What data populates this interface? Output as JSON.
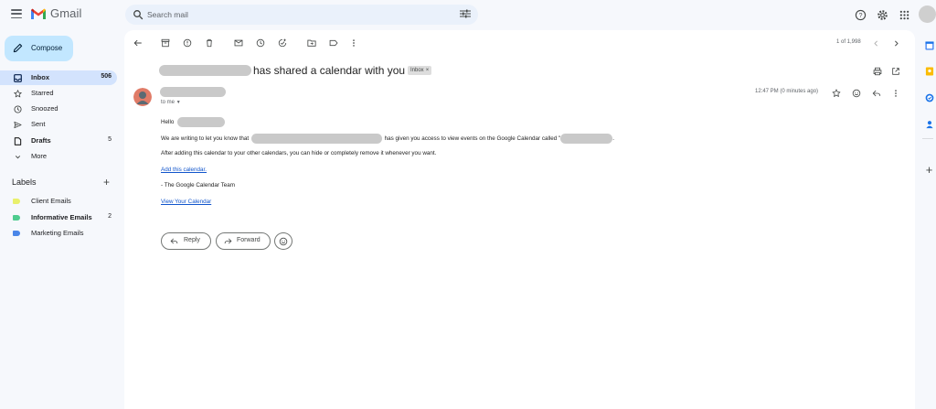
{
  "header": {
    "app_name": "Gmail",
    "search_placeholder": "Search mail"
  },
  "sidebar": {
    "compose_label": "Compose",
    "items": [
      {
        "label": "Inbox",
        "count": "506",
        "icon": "inbox-icon"
      },
      {
        "label": "Starred",
        "count": "",
        "icon": "star-icon"
      },
      {
        "label": "Snoozed",
        "count": "",
        "icon": "clock-icon"
      },
      {
        "label": "Sent",
        "count": "",
        "icon": "send-icon"
      },
      {
        "label": "Drafts",
        "count": "5",
        "icon": "draft-icon"
      },
      {
        "label": "More",
        "count": "",
        "icon": "chevron-down-icon"
      }
    ],
    "labels_title": "Labels",
    "labels": [
      {
        "label": "Client Emails",
        "count": "",
        "color": "#e9f06c"
      },
      {
        "label": "Informative Emails",
        "count": "2",
        "color": "#4ecc8f"
      },
      {
        "label": "Marketing Emails",
        "count": "",
        "color": "#4a86e8"
      }
    ]
  },
  "toolbar": {
    "pager": "1 of 1,998"
  },
  "email": {
    "subject": "has shared a calendar with you",
    "label_badge": "Inbox",
    "label_badge_close": "×",
    "to_me": "to me",
    "time": "12:47 PM (0 minutes ago)",
    "greeting": "Hello",
    "line1_pre": "We are writing to let you know that",
    "line1_mid": "has given you access to view events on the Google Calendar called \"",
    "line1_end": ".",
    "line2": "After adding this calendar to your other calendars, you can hide or completely remove it whenever you want.",
    "add_link": "Add this calendar.",
    "signature": "- The Google Calendar Team",
    "view_link": "View Your Calendar"
  },
  "actions": {
    "reply": "Reply",
    "forward": "Forward"
  },
  "colors": {
    "background": "#f6f8fc",
    "compose": "#c2e7ff",
    "active_nav": "#d3e3fd",
    "link": "#1155cc"
  }
}
